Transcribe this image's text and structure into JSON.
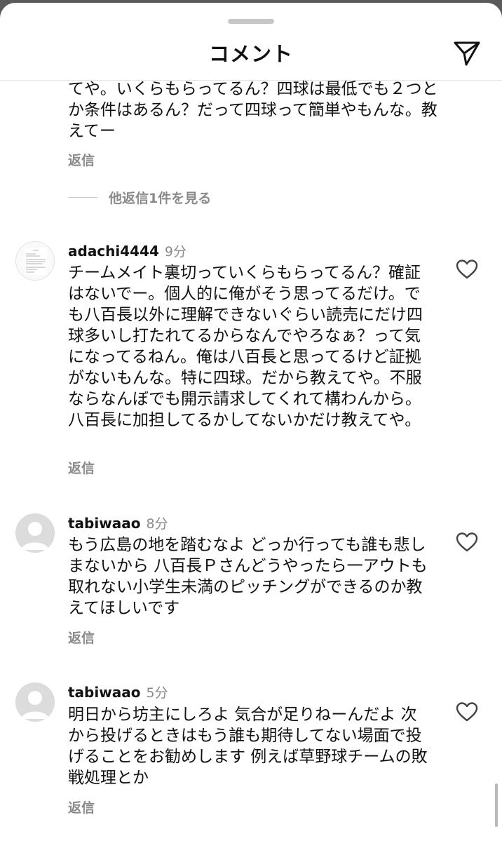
{
  "header": {
    "title": "コメント",
    "share_icon": "paper-plane-icon"
  },
  "partial_comment": {
    "text": "てや。いくらもらってるん？四球は最低でも２つとか条件はあるん？だって四球って簡単やもんな。教えてー",
    "reply_label": "返信"
  },
  "view_replies": {
    "label": "他返信1件を見る"
  },
  "comments": [
    {
      "username": "adachi4444",
      "time": "9分",
      "avatar": "document-image-avatar",
      "text": "チームメイト裏切っていくらもらってるん？確証はないでー。個人的に俺がそう思ってるだけ。でも八百長以外に理解できないぐらい読売にだけ四球多いし打たれてるからなんでやろなぁ？って気になってるねん。俺は八百長と思ってるけど証拠がないもんな。特に四球。だから教えてや。不服ならなんぼでも開示請求してくれて構わんから。八百長に加担してるかしてないかだけ教えてや。",
      "reply_label": "返信"
    },
    {
      "username": "tabiwaao",
      "time": "8分",
      "avatar": "default-user-avatar",
      "text": "もう広島の地を踏むなよ どっか行っても誰も悲しまないから 八百長Ｐさんどうやったら一アウトも取れない小学生未満のピッチングができるのか教えてほしいです",
      "reply_label": "返信"
    },
    {
      "username": "tabiwaao",
      "time": "5分",
      "avatar": "default-user-avatar",
      "text": "明日から坊主にしろよ 気合が足りねーんだよ 次から投げるときはもう誰も期待してない場面で投げることをお勧めします 例えば草野球チームの敗戦処理とか",
      "reply_label": "返信"
    }
  ],
  "colors": {
    "background": "#ffffff",
    "secondary_text": "#8a8a8a",
    "primary_text": "#111111"
  }
}
